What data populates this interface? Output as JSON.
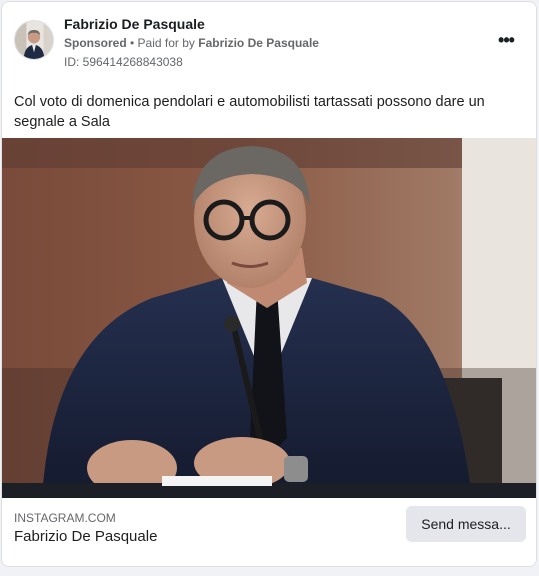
{
  "post": {
    "page_name": "Fabrizio De Pasquale",
    "sponsored_label": "Sponsored",
    "separator": " • ",
    "paid_for_prefix": "Paid for by ",
    "paid_for_name": "Fabrizio De Pasquale",
    "ad_id": "ID: 596414268843038",
    "more_options_glyph": "•••",
    "body_text": "Col voto di domenica pendolari e automobilisti tartassati possono dare un segnale a Sala"
  },
  "link_preview": {
    "domain": "INSTAGRAM.COM",
    "title": "Fabrizio De Pasquale",
    "cta_label": "Send messa..."
  },
  "icons": {
    "more": "more-options-icon"
  },
  "colors": {
    "card_background": "#ffffff",
    "page_background": "#f0f2f5",
    "primary_text": "#1c1e21",
    "secondary_text": "#65676b",
    "button_background": "#e4e6eb"
  }
}
